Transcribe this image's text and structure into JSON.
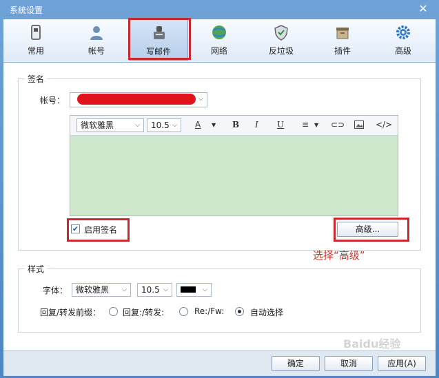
{
  "window": {
    "title": "系统设置",
    "close_label": "✕"
  },
  "toolbar": {
    "items": [
      {
        "label": "常用",
        "icon": "general-icon"
      },
      {
        "label": "帐号",
        "icon": "account-icon"
      },
      {
        "label": "写邮件",
        "icon": "compose-icon"
      },
      {
        "label": "网络",
        "icon": "network-icon"
      },
      {
        "label": "反垃圾",
        "icon": "antispam-icon"
      },
      {
        "label": "插件",
        "icon": "plugin-icon"
      },
      {
        "label": "高级",
        "icon": "gear-icon"
      }
    ],
    "active_index": 2
  },
  "signature": {
    "group_title": "签名",
    "account_label": "帐号：",
    "account_value": "",
    "editor": {
      "font": "微软雅黑",
      "size": "10.5",
      "bold": "B",
      "italic": "I",
      "underline": "U",
      "source": "</>"
    },
    "enable_label": "启用签名",
    "enable_checked": true,
    "advanced_button": "高级..."
  },
  "annotation": "选择“高级”",
  "style": {
    "group_title": "样式",
    "font_label": "字体：",
    "font_value": "微软雅黑",
    "size_value": "10.5",
    "prefix_label": "回复/转发前缀：",
    "options": [
      "回复:/转发:",
      "Re:/Fw:",
      "自动选择"
    ],
    "selected_index": 2
  },
  "footer": {
    "ok": "确定",
    "cancel": "取消",
    "apply": "应用(A)"
  },
  "watermark": "Baidu经验",
  "colors": {
    "accent": "#4e86c2",
    "highlight": "#c8282e",
    "editor_bg": "#cde8cd",
    "annotation": "#c83a2f"
  }
}
